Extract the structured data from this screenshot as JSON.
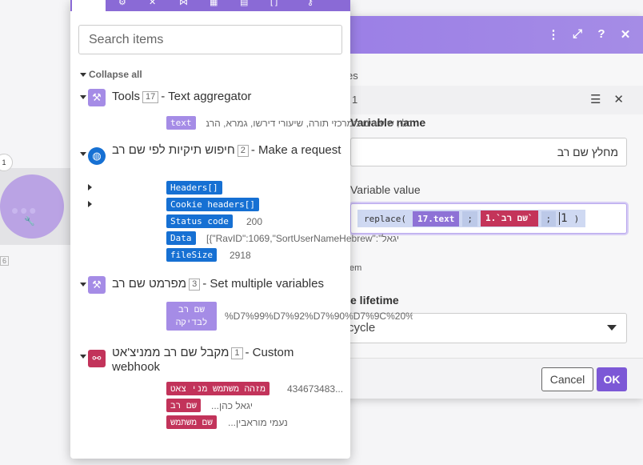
{
  "canvas": {
    "node_badge": "1",
    "node_count": "6"
  },
  "dialog": {
    "header_icons": [
      "⋮",
      "⤢",
      "?",
      "✕"
    ],
    "es_text": "es",
    "item_number": "1",
    "item_icons": [
      "☰",
      "✕"
    ],
    "variable_name_label": "Variable name",
    "variable_name_value": "מחלץ שם רב",
    "variable_value_label": "Variable value",
    "formula": {
      "fn": "replace(",
      "arg1": "17.text",
      "sep1": ";",
      "arg2": "1.`שם רב`",
      "sep2": ";",
      "arg3": "1",
      "close": ")"
    },
    "item_text": "tem",
    "lifetime_label": "e lifetime",
    "lifetime_value": "cycle",
    "cancel_label": "Cancel",
    "ok_label": "OK"
  },
  "panel": {
    "search_placeholder": "Search items",
    "collapse_all": "Collapse all",
    "modules": [
      {
        "name": "Tools",
        "number": "17",
        "type": "- Text aggregator",
        "icon": "wrench-icon",
        "color": "#a58ce6",
        "items": [
          {
            "tag": "text",
            "value": "בלי, שיעורים ממרכזי תורה, שיעורי דירשו, גמרא, הרב י"
          }
        ]
      },
      {
        "name": "חיפוש תיקיות לפי שם רב",
        "number": "2",
        "type": "- Make a request",
        "icon": "globe-icon",
        "color": "#1670d3",
        "items": [
          {
            "tag": "Headers[]",
            "value": ""
          },
          {
            "tag": "Cookie headers[]",
            "value": ""
          },
          {
            "tag": "Status code",
            "value": "200"
          },
          {
            "tag": "Data",
            "value": "[{\"RavID\":1069,\"SortUserNameHebrew\":\"יגאל"
          },
          {
            "tag": "fileSize",
            "value": "2918"
          }
        ]
      },
      {
        "name": "מפרמט שם רב",
        "number": "3",
        "type": "- Set multiple variables",
        "icon": "wrench-icon",
        "color": "#a58ce6",
        "items": [
          {
            "tag": "שם רב לבדיקה",
            "value": "%D7%99%D7%92%D7%90%D7%9C%20%"
          }
        ]
      },
      {
        "name": "מקבל שם רב ממניצ'אט",
        "number": "1",
        "type": "- Custom webhook",
        "icon": "webhook-icon",
        "color": "#c2335a",
        "items": [
          {
            "tag": "מזהה משתמש מני צאט",
            "value": "434673483..."
          },
          {
            "tag": "שם רב",
            "value": "יגאל כהן..."
          },
          {
            "tag": "שם משתמש",
            "value": "נעמי מוראבין..."
          }
        ]
      }
    ]
  }
}
